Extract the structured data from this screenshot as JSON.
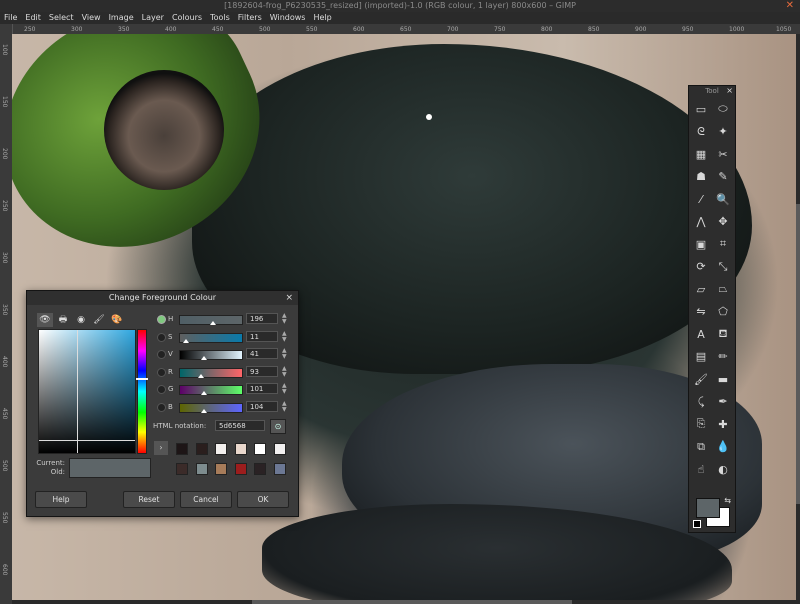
{
  "window": {
    "title": "[1892604-frog_P6230535_resized] (imported)-1.0 (RGB colour, 1 layer) 800x600 – GIMP",
    "close_glyph": "✕"
  },
  "menu": [
    "File",
    "Edit",
    "Select",
    "View",
    "Image",
    "Layer",
    "Colours",
    "Tools",
    "Filters",
    "Windows",
    "Help"
  ],
  "rulers": {
    "top": [
      "250",
      "300",
      "350",
      "400",
      "450",
      "500",
      "550",
      "600",
      "650",
      "700",
      "750",
      "800",
      "850",
      "900",
      "950",
      "1000",
      "1050"
    ],
    "left": [
      "100",
      "150",
      "200",
      "250",
      "300",
      "350",
      "400",
      "450",
      "500",
      "550",
      "600"
    ]
  },
  "toolbox": {
    "title": "Tool",
    "close_glyph": "×",
    "tools": [
      {
        "name": "rect-select-icon",
        "glyph": "▭"
      },
      {
        "name": "ellipse-select-icon",
        "glyph": "⬭"
      },
      {
        "name": "free-select-icon",
        "glyph": "ᘓ"
      },
      {
        "name": "fuzzy-select-icon",
        "glyph": "✦"
      },
      {
        "name": "color-select-icon",
        "glyph": "▦"
      },
      {
        "name": "scissors-select-icon",
        "glyph": "✂"
      },
      {
        "name": "foreground-select-icon",
        "glyph": "☗"
      },
      {
        "name": "paths-icon",
        "glyph": "✎"
      },
      {
        "name": "color-picker-icon",
        "glyph": "⁄"
      },
      {
        "name": "zoom-icon",
        "glyph": "🔍"
      },
      {
        "name": "measure-icon",
        "glyph": "⋀"
      },
      {
        "name": "move-icon",
        "glyph": "✥"
      },
      {
        "name": "align-icon",
        "glyph": "▣"
      },
      {
        "name": "crop-icon",
        "glyph": "⌗"
      },
      {
        "name": "rotate-icon",
        "glyph": "⟳"
      },
      {
        "name": "scale-icon",
        "glyph": "⤡"
      },
      {
        "name": "shear-icon",
        "glyph": "▱"
      },
      {
        "name": "perspective-icon",
        "glyph": "⏢"
      },
      {
        "name": "flip-icon",
        "glyph": "⇋"
      },
      {
        "name": "cage-icon",
        "glyph": "⬠"
      },
      {
        "name": "text-icon",
        "glyph": "A"
      },
      {
        "name": "bucket-fill-icon",
        "glyph": "⛾"
      },
      {
        "name": "gradient-icon",
        "glyph": "▤"
      },
      {
        "name": "pencil-icon",
        "glyph": "✏"
      },
      {
        "name": "paintbrush-icon",
        "glyph": "🖌"
      },
      {
        "name": "eraser-icon",
        "glyph": "▬"
      },
      {
        "name": "airbrush-icon",
        "glyph": "⤹"
      },
      {
        "name": "ink-icon",
        "glyph": "✒"
      },
      {
        "name": "clone-icon",
        "glyph": "⎘"
      },
      {
        "name": "heal-icon",
        "glyph": "✚"
      },
      {
        "name": "perspective-clone-icon",
        "glyph": "⧉"
      },
      {
        "name": "blur-icon",
        "glyph": "💧"
      },
      {
        "name": "smudge-icon",
        "glyph": "☝"
      },
      {
        "name": "dodge-burn-icon",
        "glyph": "◐"
      }
    ],
    "foreground_color": "#5d6568",
    "background_color": "#ffffff",
    "swap_glyph": "⇆"
  },
  "dialog": {
    "title": "Change Foreground Colour",
    "close_glyph": "×",
    "selector_tabs": [
      {
        "name": "gimp-selector-icon",
        "glyph": "👁"
      },
      {
        "name": "cmyk-selector-icon",
        "glyph": "🖶"
      },
      {
        "name": "wheel-selector-icon",
        "glyph": "◉"
      },
      {
        "name": "watercolor-selector-icon",
        "glyph": "🖌"
      },
      {
        "name": "palette-selector-icon",
        "glyph": "🎨"
      }
    ],
    "sliders": [
      {
        "label": "H",
        "value": "196",
        "selected": true,
        "pos": 0.55,
        "gradient": "linear-gradient(90deg,#505f66,#5d6568)"
      },
      {
        "label": "S",
        "value": "11",
        "selected": false,
        "pos": 0.11,
        "gradient": "linear-gradient(90deg,#5f5f5f,#0a7aaa)"
      },
      {
        "label": "V",
        "value": "41",
        "selected": false,
        "pos": 0.41,
        "gradient": "linear-gradient(90deg,#000000,#e2f4ff)"
      },
      {
        "label": "R",
        "value": "93",
        "selected": false,
        "pos": 0.36,
        "gradient": "linear-gradient(90deg,#006568,#ff6568)"
      },
      {
        "label": "G",
        "value": "101",
        "selected": false,
        "pos": 0.4,
        "gradient": "linear-gradient(90deg,#5d0068,#5dff68)"
      },
      {
        "label": "B",
        "value": "104",
        "selected": false,
        "pos": 0.41,
        "gradient": "linear-gradient(90deg,#5d6500,#5d65ff)"
      }
    ],
    "html_notation_label": "HTML notation:",
    "html_notation_value": "5d6568",
    "current_label": "Current:",
    "old_label": "Old:",
    "current_color": "#5d6568",
    "history_arrow": "›",
    "history_row1": [
      "#1d1516",
      "#2a1e1d",
      "#f3f0ee",
      "#e9d7cc",
      "#ffffff",
      "#f2f0f0"
    ],
    "history_row2": [
      "#3b2b29",
      "#7d8c8e",
      "#a77c5a",
      "#9c1d1d",
      "#2a2224",
      "#6c7894"
    ],
    "buttons": {
      "help": "Help",
      "reset": "Reset",
      "cancel": "Cancel",
      "ok": "OK"
    }
  }
}
